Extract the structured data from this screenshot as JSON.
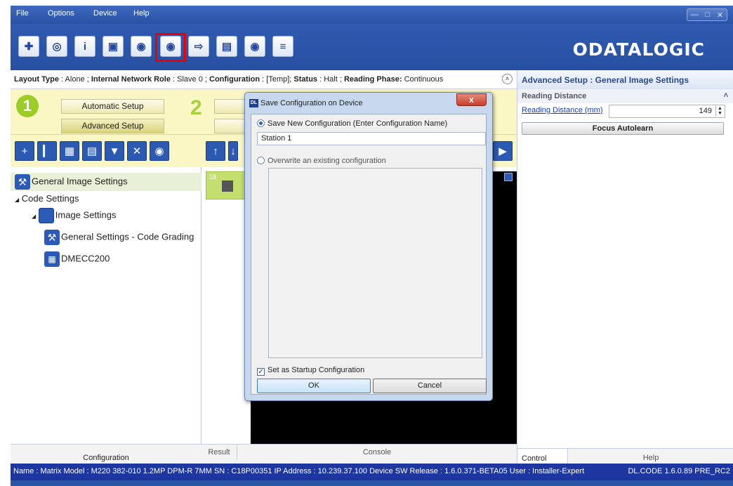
{
  "menu": {
    "file": "File",
    "options": "Options",
    "device": "Device",
    "help": "Help"
  },
  "logo": "ODATALOGIC",
  "status_line": {
    "layout_type_label": "Layout Type",
    "layout_type_value": ": Alone ;",
    "role_label": "Internal Network Role",
    "role_value": ": Slave 0 ;",
    "config_label": "Configuration",
    "config_value": ": [Temp];",
    "status_label": "Status",
    "status_value": ": Halt ;",
    "phase_label": "Reading Phase:",
    "phase_value": "Continuous"
  },
  "setup": {
    "step1": "1",
    "step2": "2",
    "automatic": "Automatic Setup",
    "advanced": "Advanced Setup"
  },
  "tree": {
    "root": "General Image Settings",
    "code_settings": "Code Settings",
    "image_settings": "Image Settings",
    "general_grading": "General Settings - Code Grading",
    "dmecc": "DMECC200"
  },
  "thumb_number": "18",
  "left_tab": "Configuration",
  "center_tabs": {
    "result": "Result",
    "console": "Console"
  },
  "right_panel": {
    "header": "Advanced Setup : General Image Settings",
    "section": "Reading Distance",
    "field_label": "Reading Distance (mm)",
    "field_value": "149",
    "focus_button": "Focus Autolearn",
    "tab_control": "Control",
    "tab_help": "Help"
  },
  "status_bar": {
    "left": "Name : Matrix  Model : M220 382-010 1.2MP DPM-R 7MM   SN : C18P00351   IP Address : 10.239.37.100   Device SW Release : 1.6.0.371-BETA05   User : Installer-Expert",
    "right": "DL.CODE 1.6.0.89 PRE_RC2"
  },
  "dialog": {
    "title": "Save Configuration on Device",
    "icon_text": "DL",
    "close": "x",
    "save_new_label": "Save New Configuration (Enter Configuration Name)",
    "config_name": "Station 1",
    "overwrite_label": "Overwrite an existing configuration",
    "startup_label": "Set as Startup Configuration",
    "ok": "OK",
    "cancel": "Cancel"
  }
}
